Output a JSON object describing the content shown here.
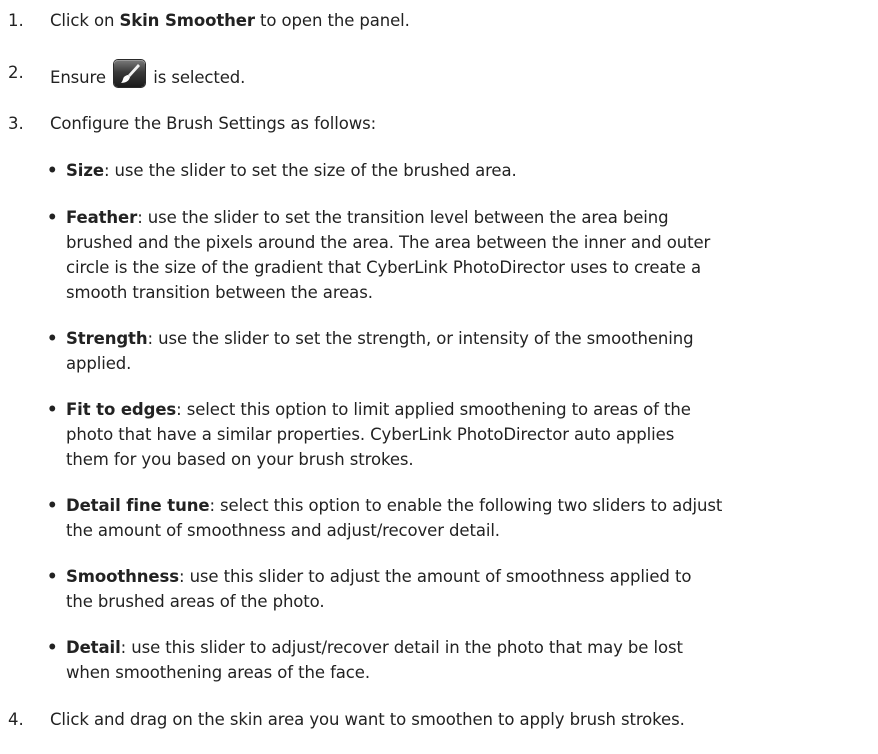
{
  "steps": [
    {
      "num": "1.",
      "pre": "Click on ",
      "bold": "Skin Smoother",
      "post": " to open the panel."
    },
    {
      "num": "2.",
      "pre": "Ensure",
      "post": "is selected.",
      "icon": "brush-icon"
    },
    {
      "num": "3.",
      "text": "Configure the Brush Settings as follows:"
    },
    {
      "num": "4.",
      "text": "Click and drag on the skin area you want to smoothen to apply brush strokes."
    }
  ],
  "bullet_glyph": "•",
  "bullets": [
    {
      "term": "Size",
      "lines": [
        ": use the slider to set the size of the brushed area."
      ]
    },
    {
      "term": "Feather",
      "lines": [
        ": use the slider to set the transition level between the area being",
        "brushed and the pixels around the area. The area between the inner and outer",
        "circle is the size of the gradient that CyberLink PhotoDirector uses to create a",
        "smooth transition between the areas."
      ]
    },
    {
      "term": "Strength",
      "lines": [
        ": use the slider to set the strength, or intensity of the smoothening",
        "applied."
      ]
    },
    {
      "term": "Fit to edges",
      "lines": [
        ": select this option to limit applied smoothening to areas of the",
        "photo that have a similar properties. CyberLink PhotoDirector auto applies",
        "them for you based on your brush strokes."
      ]
    },
    {
      "term": "Detail fine tune",
      "lines": [
        ": select this option to enable the following two sliders to adjust",
        "the amount of smoothness and adjust/recover detail."
      ]
    },
    {
      "term": "Smoothness",
      "lines": [
        ": use this slider to adjust the amount of smoothness applied to",
        "the brushed areas of the photo."
      ]
    },
    {
      "term": "Detail",
      "lines": [
        ": use this slider to adjust/recover detail in the photo that may be lost",
        "when smoothening areas of the face."
      ]
    }
  ]
}
